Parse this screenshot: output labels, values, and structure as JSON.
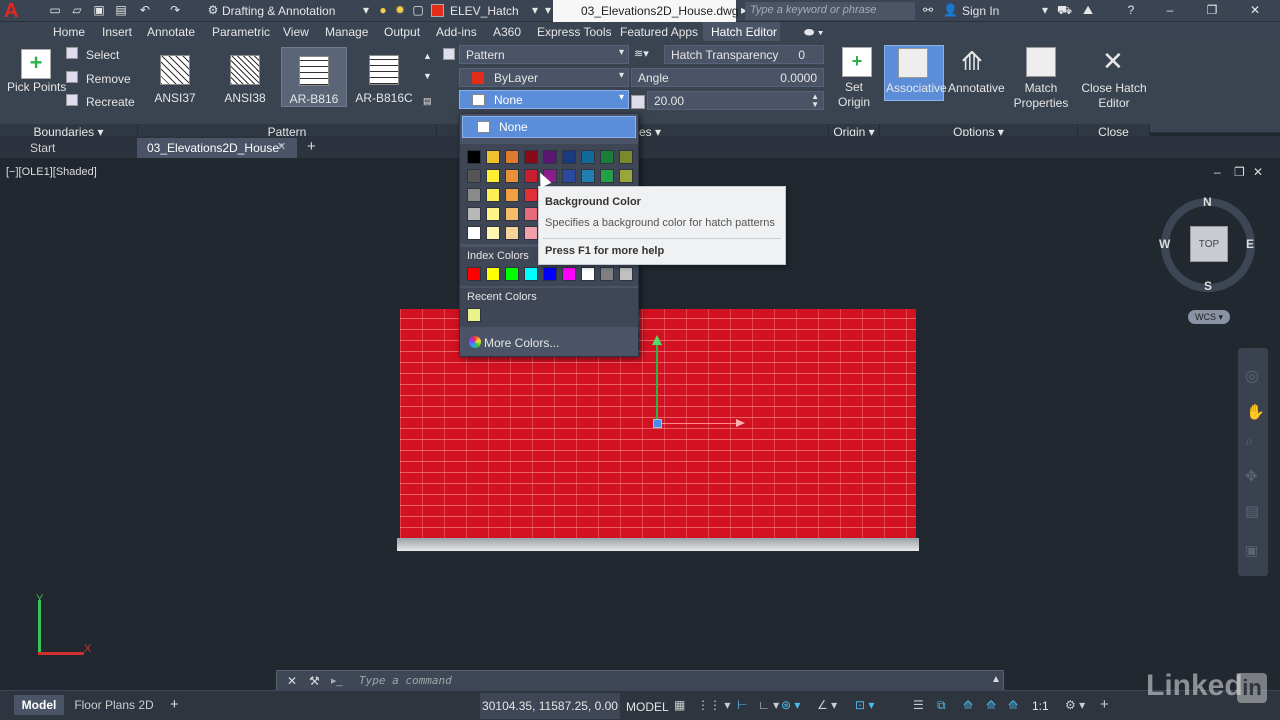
{
  "titlebar": {
    "workspace": "Drafting & Annotation",
    "layer": "ELEV_Hatch",
    "document": "03_Elevations2D_House.dwg",
    "search_placeholder": "Type a keyword or phrase",
    "signin": "Sign In",
    "layer_color": "#e02e1b"
  },
  "menubar": {
    "items": [
      "Home",
      "Insert",
      "Annotate",
      "Parametric",
      "View",
      "Manage",
      "Output",
      "Add-ins",
      "A360",
      "Express Tools",
      "Featured Apps",
      "Hatch Editor"
    ]
  },
  "ribbon": {
    "pick_points": "Pick Points",
    "boundaries": {
      "select": "Select",
      "remove": "Remove",
      "recreate": "Recreate",
      "label": "Boundaries"
    },
    "patterns": [
      {
        "name": "ANSI37"
      },
      {
        "name": "ANSI38"
      },
      {
        "name": "AR-B816"
      },
      {
        "name": "AR-B816C"
      }
    ],
    "pattern_label": "Pattern",
    "properties": {
      "pattern_type": "Pattern",
      "color": "ByLayer",
      "bgcolor": "None",
      "transparency_label": "Hatch Transparency",
      "transparency_value": "0",
      "angle_label": "Angle",
      "angle_value": "0.0000",
      "scale_value": "20.00",
      "label_suffix": "es"
    },
    "origin": {
      "set_origin": "Set Origin",
      "label": "Origin"
    },
    "options": {
      "associative": "Associative",
      "annotative": "Annotative",
      "match": "Match Properties",
      "label": "Options"
    },
    "close": {
      "label_btn": "Close Hatch Editor",
      "label": "Close"
    }
  },
  "doc_tabs": {
    "start": "Start",
    "active": "03_Elevations2D_House*"
  },
  "viewport": {
    "label": "[−][OLE1][Shaded]",
    "wcs": "WCS",
    "top": "TOP",
    "n": "N",
    "s": "S",
    "e": "E",
    "w": "W"
  },
  "palette": {
    "none": "None",
    "index_label": "Index Colors",
    "recent_label": "Recent Colors",
    "more": "More Colors...",
    "grid": [
      [
        "#000000",
        "#f2c12e",
        "#e07a2e",
        "#8b0a1a",
        "#5a1670",
        "#1a3a80",
        "#0f6a9a",
        "#1a7d3a",
        "#7a8a2a"
      ],
      [
        "#555555",
        "#ffee33",
        "#e88f3a",
        "#c81e2e",
        "#8e1b8c",
        "#2a4aa0",
        "#1f7fb0",
        "#25a04a",
        "#9aa53a"
      ],
      [
        "#8a8a8a",
        "#ffef55",
        "#f0a040",
        "#e2303a",
        "#000000",
        "#000000",
        "#000000",
        "#000000",
        "#000000"
      ],
      [
        "#b8b8b8",
        "#fff488",
        "#f5bc6a",
        "#e86a7a",
        "#000000",
        "#000000",
        "#000000",
        "#000000",
        "#000000"
      ],
      [
        "#ffffff",
        "#fff6b0",
        "#f7d49a",
        "#f2a0aa",
        "#000000",
        "#000000",
        "#000000",
        "#000000",
        "#000000"
      ]
    ],
    "index_colors": [
      "#ff0000",
      "#ffff00",
      "#00ff00",
      "#00ffff",
      "#0000ff",
      "#ff00ff",
      "#ffffff",
      "#808080",
      "#c0c0c0"
    ],
    "recent_colors": [
      "#e8f48a"
    ]
  },
  "tooltip": {
    "title": "Background Color",
    "desc": "Specifies a background color for hatch patterns",
    "help": "Press F1 for more help"
  },
  "command": {
    "placeholder": "Type a command"
  },
  "status": {
    "model_tab": "Model",
    "layout_tab": "Floor Plans 2D",
    "coords": "30104.35, 11587.25, 0.00",
    "model": "MODEL",
    "scale": "1:1",
    "brand": "Linked"
  }
}
